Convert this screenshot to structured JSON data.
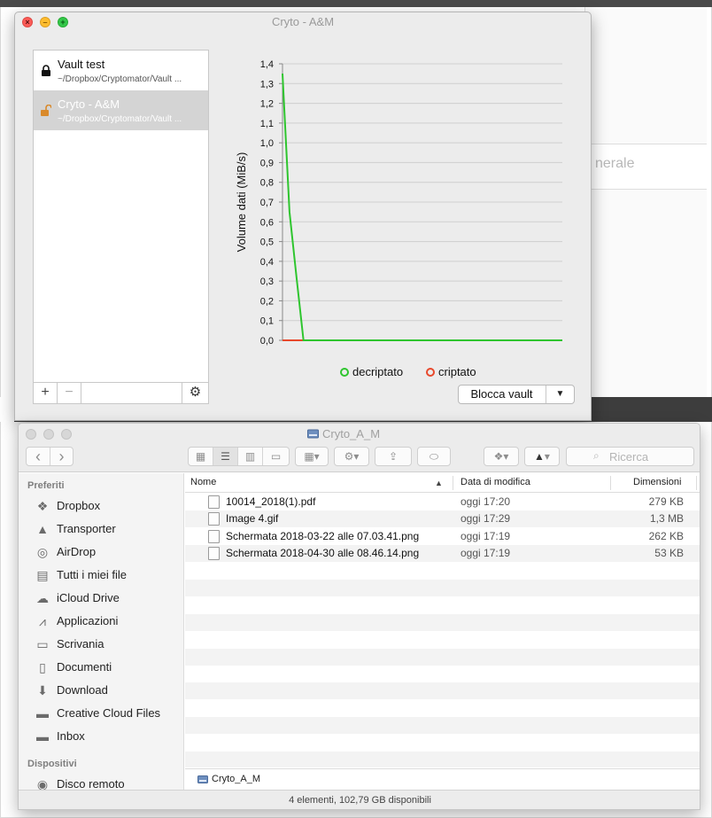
{
  "background": {
    "partial_text": "nerale"
  },
  "crypto_window": {
    "title": "Cryto - A&M",
    "vaults": [
      {
        "name": "Vault test",
        "path": "~/Dropbox/Cryptomator/Vault ...",
        "locked": true,
        "selected": false
      },
      {
        "name": "Cryto - A&M",
        "path": "~/Dropbox/Cryptomator/Vault ...",
        "locked": false,
        "selected": true
      }
    ],
    "add_label": "+",
    "remove_label": "−",
    "settings_icon": "gear-icon",
    "lock_button_label": "Blocca vault",
    "lock_button_arrow": "▼"
  },
  "chart_data": {
    "type": "line",
    "ylabel": "Volume dati (MiB/s)",
    "ylim": [
      0,
      1.4
    ],
    "y_ticks": [
      "0,0",
      "0,1",
      "0,2",
      "0,3",
      "0,4",
      "0,5",
      "0,6",
      "0,7",
      "0,8",
      "0,9",
      "1,0",
      "1,1",
      "1,2",
      "1,3",
      "1,4"
    ],
    "grid": true,
    "legend_position": "bottom",
    "x": [
      0,
      1,
      2,
      3,
      4,
      5,
      6,
      7,
      8,
      9,
      10,
      11,
      12,
      13,
      14,
      15,
      16,
      17,
      18,
      19,
      20,
      21,
      22,
      23,
      24,
      25,
      26,
      27,
      28,
      29,
      30,
      31,
      32,
      33,
      34,
      35,
      36,
      37,
      38,
      39,
      40
    ],
    "series": [
      {
        "name": "decriptato",
        "color": "#2ec52e",
        "values": [
          1.35,
          0.65,
          0.32,
          0,
          0,
          0,
          0,
          0,
          0,
          0,
          0,
          0,
          0,
          0,
          0,
          0,
          0,
          0,
          0,
          0,
          0,
          0,
          0,
          0,
          0,
          0,
          0,
          0,
          0,
          0,
          0,
          0,
          0,
          0,
          0,
          0,
          0,
          0,
          0,
          0,
          0
        ]
      },
      {
        "name": "criptato",
        "color": "#e8482b",
        "values": [
          0,
          0,
          0,
          0,
          0,
          0,
          0,
          0,
          0,
          0,
          0,
          0,
          0,
          0,
          0,
          0,
          0,
          0,
          0,
          0,
          0,
          0,
          0,
          0,
          0,
          0,
          0,
          0,
          0,
          0,
          0,
          0,
          0,
          0,
          0,
          0,
          0,
          0,
          0,
          0,
          0
        ]
      }
    ]
  },
  "finder": {
    "title": "Cryto_A_M",
    "search_placeholder": "Ricerca",
    "toolbar": {
      "back": "‹",
      "forward": "›",
      "view_icons": [
        "icon-view-icon",
        "list-view-icon",
        "column-view-icon",
        "cover-flow-icon"
      ],
      "arrange": "▾",
      "action": "▾",
      "share_icon": "share-icon",
      "tag_icon": "tag-icon",
      "dropbox": "▾",
      "transporter": "▾"
    },
    "sidebar": {
      "favorites_label": "Preferiti",
      "favorites": [
        {
          "label": "Dropbox",
          "icon": "dropbox-icon"
        },
        {
          "label": "Transporter",
          "icon": "transporter-icon"
        },
        {
          "label": "AirDrop",
          "icon": "airdrop-icon"
        },
        {
          "label": "Tutti i miei file",
          "icon": "all-files-icon"
        },
        {
          "label": "iCloud Drive",
          "icon": "cloud-icon"
        },
        {
          "label": "Applicazioni",
          "icon": "applications-icon"
        },
        {
          "label": "Scrivania",
          "icon": "desktop-icon"
        },
        {
          "label": "Documenti",
          "icon": "documents-icon"
        },
        {
          "label": "Download",
          "icon": "download-icon"
        },
        {
          "label": "Creative Cloud Files",
          "icon": "folder-icon"
        },
        {
          "label": "Inbox",
          "icon": "folder-icon"
        }
      ],
      "devices_label": "Dispositivi",
      "devices": [
        {
          "label": "Disco remoto",
          "icon": "disc-icon"
        }
      ]
    },
    "columns": {
      "name": "Nome",
      "date": "Data di modifica",
      "size": "Dimensioni"
    },
    "files": [
      {
        "name": "10014_2018(1).pdf",
        "date": "oggi 17:20",
        "size": "279 KB"
      },
      {
        "name": "Image 4.gif",
        "date": "oggi 17:29",
        "size": "1,3 MB"
      },
      {
        "name": "Schermata 2018-03-22 alle 07.03.41.png",
        "date": "oggi 17:19",
        "size": "262 KB"
      },
      {
        "name": "Schermata 2018-04-30 alle 08.46.14.png",
        "date": "oggi 17:19",
        "size": "53 KB"
      }
    ],
    "path_label": "Cryto_A_M",
    "status": "4 elementi, 102,79 GB disponibili"
  }
}
